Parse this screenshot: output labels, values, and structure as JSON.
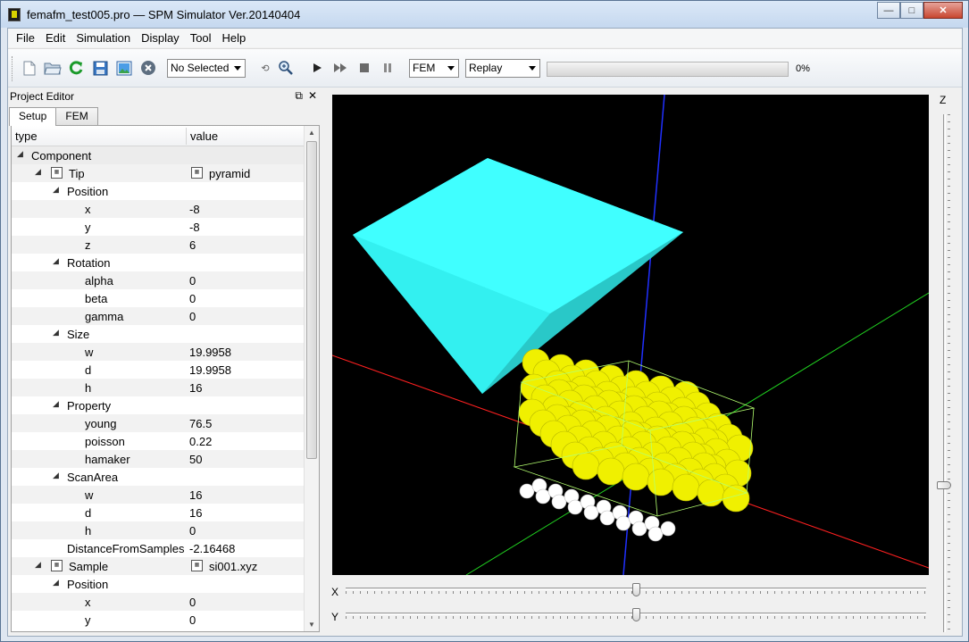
{
  "window": {
    "title": "femafm_test005.pro — SPM Simulator Ver.20140404",
    "minimize": "—",
    "maximize": "□",
    "close": "✕"
  },
  "menu": [
    "File",
    "Edit",
    "Simulation",
    "Display",
    "Tool",
    "Help"
  ],
  "toolbar": {
    "icons": [
      "new-file-icon",
      "open-folder-icon",
      "reload-icon",
      "save-icon",
      "image-icon",
      "close-circle-icon"
    ],
    "selection_combo": "No Selected",
    "mode_combo": "FEM",
    "playback_combo": "Replay",
    "progress": 0,
    "progress_text": "0%"
  },
  "dock": {
    "title": "Project Editor",
    "float_glyph": "⧉",
    "close_glyph": "✕",
    "tabs": [
      "Setup",
      "FEM"
    ],
    "columns": [
      "type",
      "value"
    ],
    "rows": [
      {
        "label": "Component",
        "value": "",
        "depth": 0,
        "expander": true,
        "group": true
      },
      {
        "label": "Tip",
        "value": "pyramid",
        "depth": 1,
        "expander": true,
        "icon": true,
        "value_icon": true
      },
      {
        "label": "Position",
        "value": "",
        "depth": 2,
        "expander": true
      },
      {
        "label": "x",
        "value": "-8",
        "depth": 3
      },
      {
        "label": "y",
        "value": "-8",
        "depth": 3
      },
      {
        "label": "z",
        "value": "6",
        "depth": 3
      },
      {
        "label": "Rotation",
        "value": "",
        "depth": 2,
        "expander": true
      },
      {
        "label": "alpha",
        "value": "0",
        "depth": 3
      },
      {
        "label": "beta",
        "value": "0",
        "depth": 3
      },
      {
        "label": "gamma",
        "value": "0",
        "depth": 3
      },
      {
        "label": "Size",
        "value": "",
        "depth": 2,
        "expander": true
      },
      {
        "label": "w",
        "value": "19.9958",
        "depth": 3
      },
      {
        "label": "d",
        "value": "19.9958",
        "depth": 3
      },
      {
        "label": "h",
        "value": "16",
        "depth": 3
      },
      {
        "label": "Property",
        "value": "",
        "depth": 2,
        "expander": true
      },
      {
        "label": "young",
        "value": "76.5",
        "depth": 3
      },
      {
        "label": "poisson",
        "value": "0.22",
        "depth": 3
      },
      {
        "label": "hamaker",
        "value": "50",
        "depth": 3
      },
      {
        "label": "ScanArea",
        "value": "",
        "depth": 2,
        "expander": true
      },
      {
        "label": "w",
        "value": "16",
        "depth": 3
      },
      {
        "label": "d",
        "value": "16",
        "depth": 3
      },
      {
        "label": "h",
        "value": "0",
        "depth": 3
      },
      {
        "label": "DistanceFromSamples",
        "value": "-2.16468",
        "depth": 2
      },
      {
        "label": "Sample",
        "value": "si001.xyz",
        "depth": 1,
        "expander": true,
        "icon": true,
        "value_icon": true
      },
      {
        "label": "Position",
        "value": "",
        "depth": 2,
        "expander": true
      },
      {
        "label": "x",
        "value": "0",
        "depth": 3
      },
      {
        "label": "y",
        "value": "0",
        "depth": 3
      }
    ]
  },
  "view": {
    "x_label": "X",
    "y_label": "Y",
    "z_label": "Z",
    "x_slider": 0.5,
    "y_slider": 0.5,
    "z_slider": 0.72,
    "colors": {
      "background": "#000000",
      "tip": "#29f4f4",
      "atom_top": "#f0f000",
      "atom_bottom": "#ffffff",
      "axis_x": "#ff2020",
      "axis_y": "#20d020",
      "axis_z": "#2030ff",
      "bounding_box": "#b4ff70"
    }
  }
}
